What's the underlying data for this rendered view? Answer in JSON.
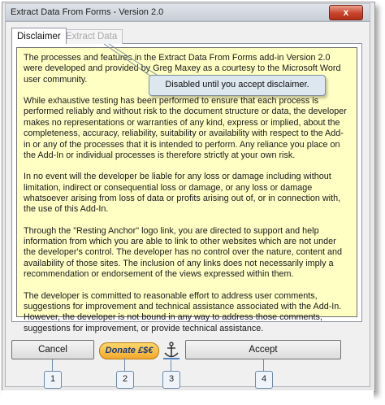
{
  "window": {
    "title": "Extract Data From Forms - Version 2.0",
    "close_label": "x"
  },
  "tabs": [
    {
      "label": "Disclaimer",
      "state": "active"
    },
    {
      "label": "Extract Data",
      "state": "disabled"
    }
  ],
  "tooltip": "Disabled until you accept disclaimer.",
  "disclaimer": {
    "paragraphs": [
      "The processes and features in the Extract Data From Forms add-in Version 2.0 were developed and provided by Greg Maxey as a courtesy to the Microsoft Word user community.",
      "While exhaustive testing has been performed to ensure that each process is performed reliably and without risk to the document structure or data, the developer makes no representations or warranties of any kind, express or implied, about the completeness, accuracy, reliability, suitability or availability with respect to the Add-in or any of the processes that it is intended to perform. Any reliance you place on the Add-In or individual processes is therefore strictly at your own risk.",
      "In no event will the developer be liable for any loss or damage including without limitation, indirect or consequential loss or damage, or any loss or damage whatsoever arising from loss of data or profits arising out of, or in connection with, the use of this Add-In.",
      "Through the \"Resting Anchor\" logo link, you are directed to support and help information from which you are able to link to other websites which are not under the developer's control. The developer has no control over the nature, content and availability of those sites. The inclusion of any links does not necessarily imply a recommendation or endorsement of the views expressed within them.",
      "The developer is committed to reasonable effort to address user comments, suggestions for improvement and technical assistance associated with the Add-In.  However, the developer is not bound in any way to address those comments, suggestions for improvement, or provide technical assistance."
    ]
  },
  "buttons": {
    "cancel": "Cancel",
    "donate": "Donate £$€",
    "accept": "Accept"
  },
  "callouts": [
    "1",
    "2",
    "3",
    "4"
  ],
  "colors": {
    "disclaimer_bg": "#ffffc4",
    "tooltip_bg": "#dde7f0",
    "close_red": "#c8432b",
    "donate_gold": "#f2a82d"
  }
}
